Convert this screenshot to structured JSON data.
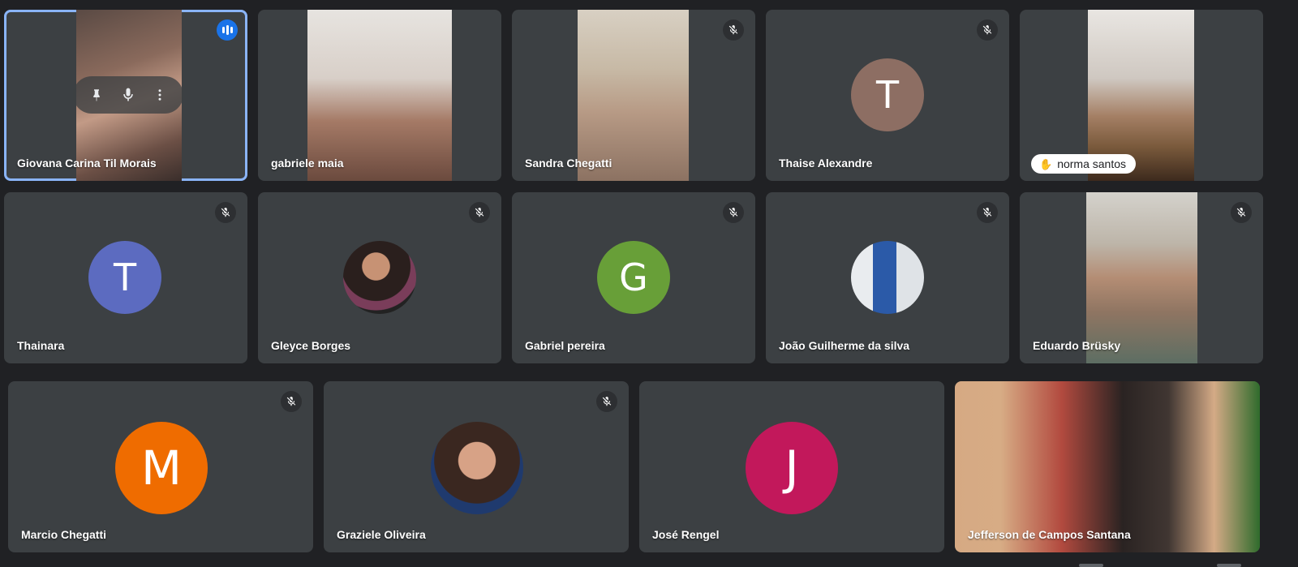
{
  "colors": {
    "background": "#202124",
    "tile": "#3c4043",
    "active_outline": "#8ab4f8",
    "speaking_badge": "#1a73e8"
  },
  "hover_controls": [
    "pin-icon",
    "microphone-icon",
    "more-vert-icon"
  ],
  "participants": [
    {
      "name": "Giovana Carina Til Morais",
      "mode": "video",
      "status": "speaking",
      "active": true
    },
    {
      "name": "gabriele maia",
      "mode": "video",
      "status": "none"
    },
    {
      "name": "Sandra Chegatti",
      "mode": "video",
      "status": "muted"
    },
    {
      "name": "Thaise Alexandre",
      "mode": "initial",
      "initial": "T",
      "avatar_color": "#8d6e63",
      "status": "muted"
    },
    {
      "name": "norma santos",
      "mode": "video",
      "status": "hand-raised"
    },
    {
      "name": "Thainara",
      "mode": "initial",
      "initial": "T",
      "avatar_color": "#5c6bc0",
      "status": "muted"
    },
    {
      "name": "Gleyce Borges",
      "mode": "photo",
      "status": "muted"
    },
    {
      "name": "Gabriel pereira",
      "mode": "initial",
      "initial": "G",
      "avatar_color": "#689f38",
      "status": "muted"
    },
    {
      "name": "João Guilherme da silva",
      "mode": "photo",
      "status": "muted"
    },
    {
      "name": "Eduardo Brüsky",
      "mode": "video",
      "status": "muted"
    },
    {
      "name": "Marcio Chegatti",
      "mode": "initial",
      "initial": "M",
      "avatar_color": "#ef6c00",
      "status": "muted"
    },
    {
      "name": "Graziele Oliveira",
      "mode": "photo",
      "status": "muted"
    },
    {
      "name": "José Rengel",
      "mode": "initial",
      "initial": "J",
      "avatar_color": "#c2185b",
      "status": "none"
    },
    {
      "name": "Jefferson de Campos Santana",
      "mode": "video",
      "status": "none"
    }
  ]
}
